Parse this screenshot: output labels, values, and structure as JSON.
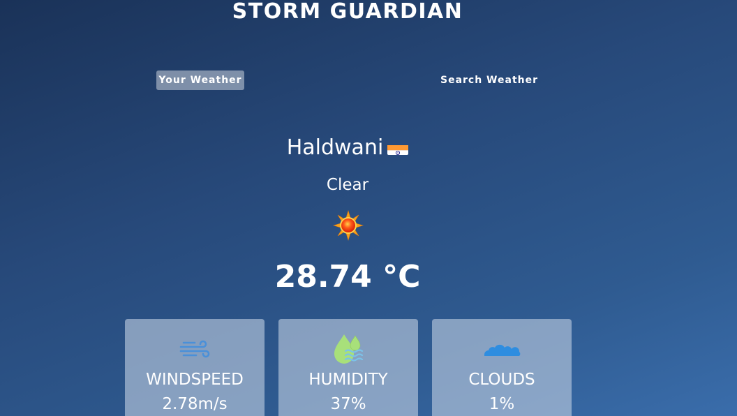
{
  "header": {
    "title": "STORM GUARDIAN"
  },
  "tabs": [
    {
      "label": "Your Weather",
      "active": true
    },
    {
      "label": "Search Weather",
      "active": false
    }
  ],
  "location": {
    "city": "Haldwani",
    "country_flag": "india-flag-icon"
  },
  "weather": {
    "condition": "Clear",
    "condition_icon": "sun-icon",
    "temperature": "28.74 °C"
  },
  "stats": [
    {
      "label": "WINDSPEED",
      "value": "2.78m/s",
      "icon": "wind-icon"
    },
    {
      "label": "HUMIDITY",
      "value": "37%",
      "icon": "humidity-icon"
    },
    {
      "label": "CLOUDS",
      "value": "1%",
      "icon": "cloud-icon"
    }
  ],
  "colors": {
    "background_top": "#1a3258",
    "background_bottom": "#3a6dab",
    "card_background": "#bccde1",
    "wind_icon": "#4a90d9",
    "humidity_icon": "#a8e07a",
    "cloud_icon": "#2e8de0"
  }
}
